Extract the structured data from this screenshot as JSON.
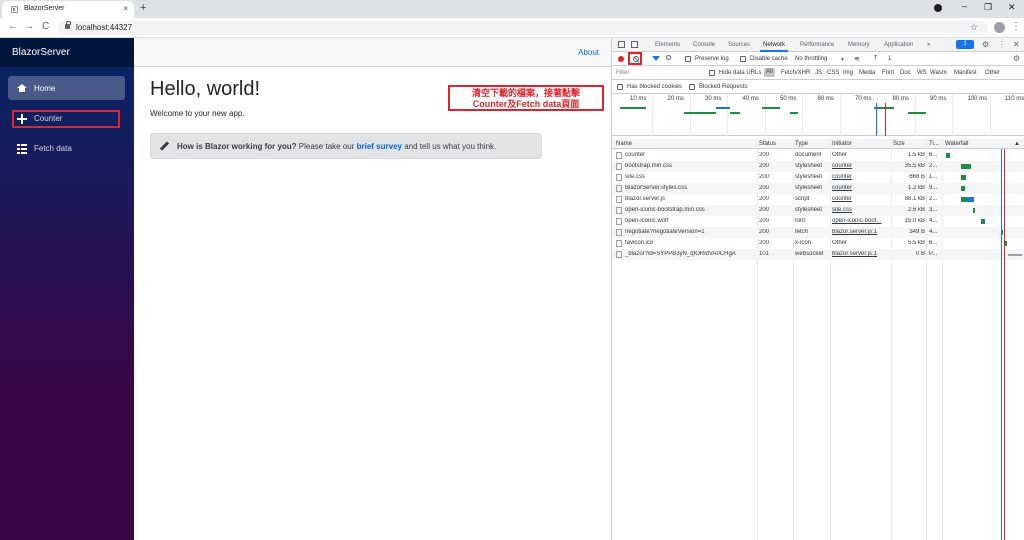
{
  "browser": {
    "tab_title": "BlazorServer",
    "tab_close": "×",
    "new_tab": "+",
    "url": "localhost:44327",
    "nav_back": "←",
    "nav_forward": "→",
    "nav_reload": "C",
    "star": "☆",
    "menu": "⋮",
    "win_min": "–",
    "win_max": "❐",
    "win_close": "✕"
  },
  "app": {
    "brand": "BlazorServer",
    "about": "About",
    "nav": [
      {
        "label": "Home",
        "icon": "home-icon",
        "active": true
      },
      {
        "label": "Counter",
        "icon": "plus-icon",
        "active": false
      },
      {
        "label": "Fetch data",
        "icon": "list-icon",
        "active": false
      }
    ],
    "heading": "Hello, world!",
    "welcome": "Welcome to your new app.",
    "survey": {
      "bold": "How is Blazor working for you?",
      "pre": " Please take our ",
      "link": "brief survey",
      "post": " and tell us what you think."
    }
  },
  "annotation": {
    "line1": "清空下載的檔案，接著點擊",
    "line2": "Counter及Fetch data頁面",
    "color": "#e0242a"
  },
  "devtools": {
    "tabs": [
      "Elements",
      "Console",
      "Sources",
      "Network",
      "Performance",
      "Memory",
      "Application"
    ],
    "active_tab": "Network",
    "more": "»",
    "badge": "1",
    "gear": "⚙",
    "more_menu": "⋮",
    "close": "✕",
    "toolbar": {
      "preserve_log": "Preserve log",
      "disable_cache": "Disable cache",
      "throttling": "No throttling",
      "caret": "▼",
      "upload": "⭡",
      "download": "⭣"
    },
    "filter": {
      "placeholder": "Filter",
      "hide_data_urls": "Hide data URLs",
      "types": [
        "All",
        "Fetch/XHR",
        "JS",
        "CSS",
        "Img",
        "Media",
        "Font",
        "Doc",
        "WS",
        "Wasm",
        "Manifest",
        "Other"
      ]
    },
    "blocked": {
      "cookies": "Has blocked cookies",
      "requests": "Blocked Requests"
    },
    "timeline_ticks": [
      "10 ms",
      "20 ms",
      "30 ms",
      "40 ms",
      "50 ms",
      "60 ms",
      "70 ms",
      "80 ms",
      "90 ms",
      "100 ms",
      "110 ms"
    ],
    "columns": [
      "Name",
      "Status",
      "Type",
      "Initiator",
      "Size",
      "Ti...",
      "Waterfall"
    ],
    "sort_caret": "▲",
    "requests": [
      {
        "name": "counter",
        "status": "200",
        "type": "document",
        "initiator": "Other",
        "init_link": false,
        "size": "1.5 kB",
        "time": "6...",
        "wf_start": 0.02,
        "wf_wait": 0.06,
        "wf_dl": 0.0
      },
      {
        "name": "bootstrap.min.css",
        "status": "200",
        "type": "stylesheet",
        "initiator": "counter",
        "init_link": true,
        "size": "35.5 kB",
        "time": "2...",
        "wf_start": 0.22,
        "wf_wait": 0.13,
        "wf_dl": 0.0
      },
      {
        "name": "site.css",
        "status": "200",
        "type": "stylesheet",
        "initiator": "counter",
        "init_link": true,
        "size": "668 B",
        "time": "1...",
        "wf_start": 0.22,
        "wf_wait": 0.06,
        "wf_dl": 0.0
      },
      {
        "name": "BlazorServer.styles.css",
        "status": "200",
        "type": "stylesheet",
        "initiator": "counter",
        "init_link": true,
        "size": "1.2 kB",
        "time": "9...",
        "wf_start": 0.22,
        "wf_wait": 0.05,
        "wf_dl": 0.0
      },
      {
        "name": "blazor.server.js",
        "status": "200",
        "type": "script",
        "initiator": "counter",
        "init_link": true,
        "size": "88.1 kB",
        "time": "2...",
        "wf_start": 0.22,
        "wf_wait": 0.07,
        "wf_dl": 0.09
      },
      {
        "name": "open-iconic-bootstrap.min.css",
        "status": "200",
        "type": "stylesheet",
        "initiator": "site.css",
        "init_link": true,
        "size": "2.6 kB",
        "time": "3...",
        "wf_start": 0.37,
        "wf_wait": 0.03,
        "wf_dl": 0.0
      },
      {
        "name": "open-iconic.woff",
        "status": "200",
        "type": "font",
        "initiator": "open-iconic-boot...",
        "init_link": true,
        "size": "15.0 kB",
        "time": "4...",
        "wf_start": 0.48,
        "wf_wait": 0.03,
        "wf_dl": 0.01
      },
      {
        "name": "negotiate?negotiateVersion=1",
        "status": "200",
        "type": "fetch",
        "initiator": "blazor.server.js:1",
        "init_link": true,
        "size": "349 B",
        "time": "4...",
        "wf_start": 0.73,
        "wf_wait": 0.03,
        "wf_dl": 0.0
      },
      {
        "name": "favicon.ico",
        "status": "200",
        "type": "x-icon",
        "initiator": "Other",
        "init_link": false,
        "size": "5.5 kB",
        "time": "6...",
        "wf_start": 0.78,
        "wf_wait": 0.03,
        "wf_dl": 0.0
      },
      {
        "name": "_blazor?id=SYPPB3yN_qIORldVA0CHgA",
        "status": "101",
        "type": "websocket",
        "initiator": "blazor.server.js:1",
        "init_link": true,
        "size": "0 B",
        "time": "P...",
        "wf_start": 0.82,
        "wf_wait": 0.0,
        "wf_dl": 0.0
      }
    ]
  }
}
